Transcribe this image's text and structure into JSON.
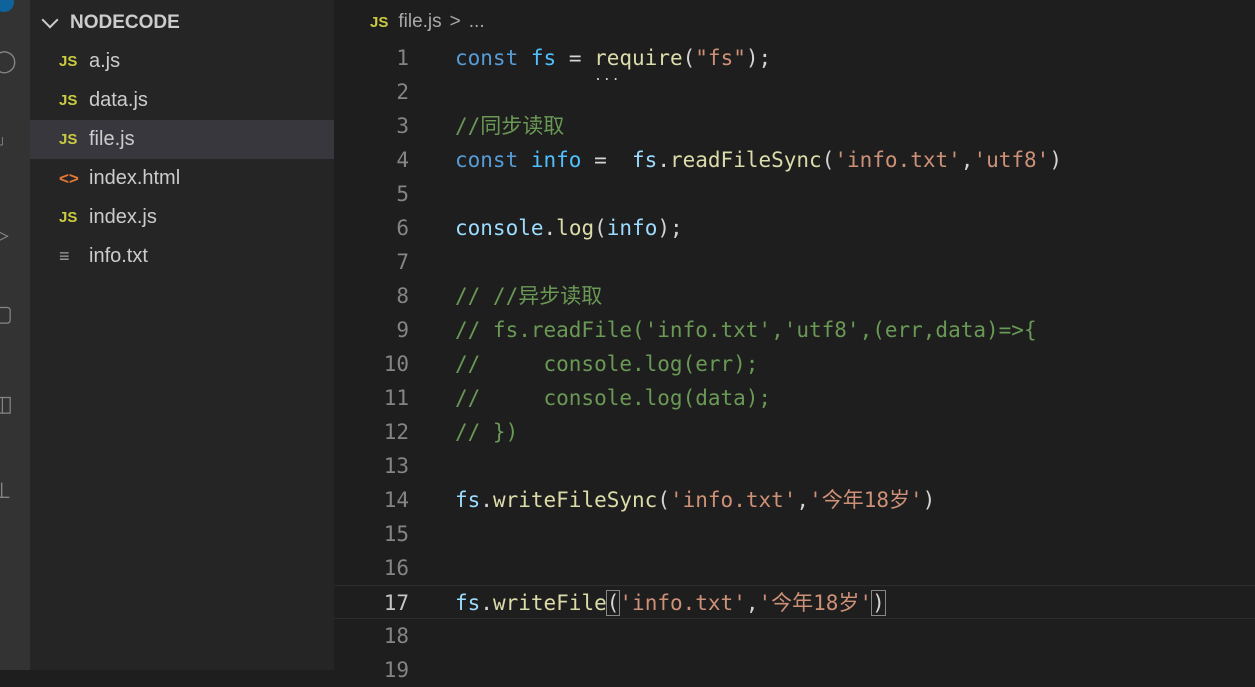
{
  "explorer": {
    "title": "NODECODE",
    "files": [
      {
        "name": "a.js",
        "icon": "js-file-icon",
        "badge": "JS",
        "kind": "js"
      },
      {
        "name": "data.js",
        "icon": "js-file-icon",
        "badge": "JS",
        "kind": "js"
      },
      {
        "name": "file.js",
        "icon": "js-file-icon",
        "badge": "JS",
        "kind": "js",
        "active": true
      },
      {
        "name": "index.html",
        "icon": "html-file-icon",
        "badge": "<>",
        "kind": "html"
      },
      {
        "name": "index.js",
        "icon": "js-file-icon",
        "badge": "JS",
        "kind": "js"
      },
      {
        "name": "info.txt",
        "icon": "text-file-icon",
        "badge": "≡",
        "kind": "txt"
      }
    ]
  },
  "breadcrumb": {
    "badge": "JS",
    "file": "file.js",
    "separator": ">",
    "more": "..."
  },
  "editor": {
    "current_line": 17,
    "lines": [
      {
        "n": "1",
        "tokens": [
          [
            "k",
            "const"
          ],
          [
            "p",
            " "
          ],
          [
            "vc",
            "fs"
          ],
          [
            "p",
            " = "
          ],
          [
            "f",
            "require"
          ],
          [
            "p",
            "("
          ],
          [
            "s",
            "\"fs\""
          ],
          [
            "p",
            ");"
          ]
        ]
      },
      {
        "n": "2",
        "tokens": []
      },
      {
        "n": "3",
        "tokens": [
          [
            "c",
            "//同步读取"
          ]
        ]
      },
      {
        "n": "4",
        "tokens": [
          [
            "k",
            "const"
          ],
          [
            "p",
            " "
          ],
          [
            "vc",
            "info"
          ],
          [
            "p",
            " =  "
          ],
          [
            "v",
            "fs"
          ],
          [
            "p",
            "."
          ],
          [
            "f",
            "readFileSync"
          ],
          [
            "p",
            "("
          ],
          [
            "s",
            "'info.txt'"
          ],
          [
            "p",
            ","
          ],
          [
            "s",
            "'utf8'"
          ],
          [
            "p",
            ")"
          ]
        ]
      },
      {
        "n": "5",
        "tokens": []
      },
      {
        "n": "6",
        "tokens": [
          [
            "v",
            "console"
          ],
          [
            "p",
            "."
          ],
          [
            "f",
            "log"
          ],
          [
            "p",
            "("
          ],
          [
            "v",
            "info"
          ],
          [
            "p",
            ");"
          ]
        ]
      },
      {
        "n": "7",
        "tokens": []
      },
      {
        "n": "8",
        "tokens": [
          [
            "c",
            "// //异步读取"
          ]
        ]
      },
      {
        "n": "9",
        "tokens": [
          [
            "c",
            "// fs.readFile('info.txt','utf8',(err,data)=>{"
          ]
        ]
      },
      {
        "n": "10",
        "tokens": [
          [
            "c",
            "//     console.log(err);"
          ]
        ]
      },
      {
        "n": "11",
        "tokens": [
          [
            "c",
            "//     console.log(data);"
          ]
        ]
      },
      {
        "n": "12",
        "tokens": [
          [
            "c",
            "// })"
          ]
        ]
      },
      {
        "n": "13",
        "tokens": []
      },
      {
        "n": "14",
        "tokens": [
          [
            "v",
            "fs"
          ],
          [
            "p",
            "."
          ],
          [
            "f",
            "writeFileSync"
          ],
          [
            "p",
            "("
          ],
          [
            "s",
            "'info.txt'"
          ],
          [
            "p",
            ","
          ],
          [
            "s",
            "'今年18岁'"
          ],
          [
            "p",
            ")"
          ]
        ]
      },
      {
        "n": "15",
        "tokens": []
      },
      {
        "n": "16",
        "tokens": []
      },
      {
        "n": "17",
        "tokens": [
          [
            "v",
            "fs"
          ],
          [
            "p",
            "."
          ],
          [
            "f",
            "writeFile"
          ],
          [
            "p bm",
            "("
          ],
          [
            "s",
            "'info.txt'"
          ],
          [
            "p",
            ","
          ],
          [
            "s",
            "'今年18岁'"
          ],
          [
            "p bm",
            ")"
          ]
        ]
      },
      {
        "n": "18",
        "tokens": []
      },
      {
        "n": "19",
        "tokens": []
      }
    ]
  }
}
